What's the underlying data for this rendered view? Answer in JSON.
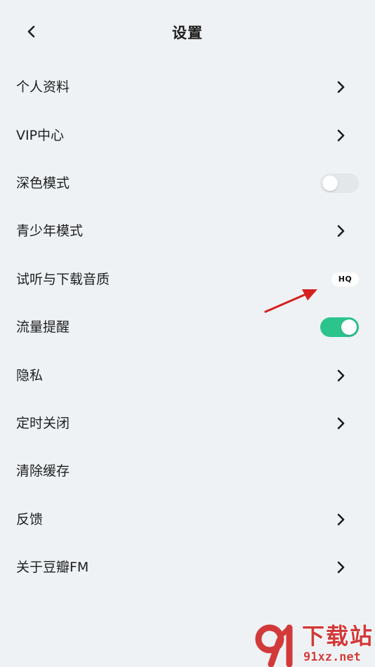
{
  "header": {
    "title": "设置",
    "back_icon": "chevron-left-icon"
  },
  "settings": [
    {
      "id": "profile",
      "label": "个人资料",
      "control": "chevron"
    },
    {
      "id": "vip-center",
      "label": "VIP中心",
      "control": "chevron"
    },
    {
      "id": "dark-mode",
      "label": "深色模式",
      "control": "toggle",
      "on": false
    },
    {
      "id": "teen-mode",
      "label": "青少年模式",
      "control": "chevron"
    },
    {
      "id": "audio-quality",
      "label": "试听与下载音质",
      "control": "badge",
      "badge": "HQ"
    },
    {
      "id": "data-alert",
      "label": "流量提醒",
      "control": "toggle",
      "on": true
    },
    {
      "id": "privacy",
      "label": "隐私",
      "control": "chevron"
    },
    {
      "id": "sleep-timer",
      "label": "定时关闭",
      "control": "chevron"
    },
    {
      "id": "clear-cache",
      "label": "清除缓存",
      "control": "none"
    },
    {
      "id": "feedback",
      "label": "反馈",
      "control": "chevron"
    },
    {
      "id": "about",
      "label": "关于豆瓣FM",
      "control": "chevron"
    }
  ],
  "watermark": {
    "title": "下载站",
    "domain": "91xz.net"
  },
  "colors": {
    "background": "#eef2f5",
    "toggle_on": "#2bc48c",
    "toggle_off": "#e3e7ea",
    "annotation_arrow": "#d62020",
    "watermark": "#d23a3a"
  }
}
